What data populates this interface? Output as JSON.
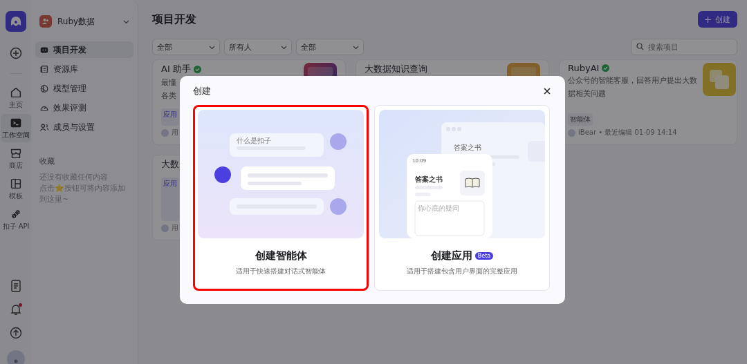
{
  "rail": {
    "items": [
      {
        "label": "主页",
        "selected": false
      },
      {
        "label": "工作空间",
        "selected": true
      },
      {
        "label": "商店",
        "selected": false
      },
      {
        "label": "模板",
        "selected": false
      },
      {
        "label": "扣子 API",
        "selected": false
      }
    ],
    "unread": true
  },
  "sidebar": {
    "team": "Ruby数据",
    "nav": [
      {
        "label": "项目开发",
        "selected": true
      },
      {
        "label": "资源库",
        "selected": false
      },
      {
        "label": "模型管理",
        "selected": false
      },
      {
        "label": "效果评测",
        "selected": false
      },
      {
        "label": "成员与设置",
        "selected": false
      }
    ],
    "favorites": {
      "title": "收藏",
      "lines": [
        "还没有收藏任何内容",
        "点击⭐按钮可将内容添加到这里~"
      ]
    }
  },
  "main": {
    "title": "项目开发",
    "create_button": "创建",
    "filters": [
      "全部",
      "所有人",
      "全部"
    ],
    "search": {
      "placeholder": "搜索项目"
    },
    "projects": [
      {
        "title": "AI 助手",
        "verified": true,
        "description": [
          "最懂",
          "各类"
        ],
        "tag": "应用",
        "author": "用"
      },
      {
        "title": "大数据知识查询",
        "verified": false
      },
      {
        "title": "RubyAI",
        "verified": true,
        "description": [
          "公众号的智能客服，回答用户提出大数",
          "据相关问题"
        ],
        "tag": "智能体",
        "author": "iBear • 最近编辑 01-09 14:14"
      },
      {
        "title": "大数",
        "verified": false,
        "tag": "应用",
        "author": "用"
      }
    ]
  },
  "dialog": {
    "title": "创建",
    "options": [
      {
        "kind": "agent",
        "title": "创建智能体",
        "description": "适用于快速搭建对话式智能体",
        "selected": true,
        "question": "什么是扣子"
      },
      {
        "kind": "app",
        "title": "创建应用",
        "badge": "Beta",
        "description": "适用于搭建包含用户界面的完整应用",
        "selected": false,
        "app_name": "答案之书",
        "app_name_front": "答案之书",
        "time": "10:09",
        "input_placeholder": "你心底的疑问"
      }
    ]
  }
}
